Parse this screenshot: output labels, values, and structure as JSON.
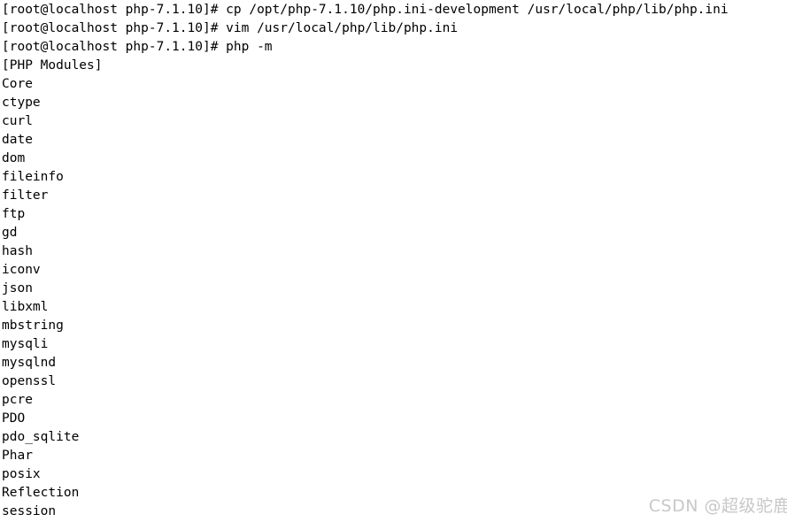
{
  "terminal": {
    "prompt": "[root@localhost php-7.1.10]#",
    "background_color": "#ffffff",
    "text_color": "#000000",
    "lines": [
      "[root@localhost php-7.1.10]# cp /opt/php-7.1.10/php.ini-development /usr/local/php/lib/php.ini",
      "[root@localhost php-7.1.10]# vim /usr/local/php/lib/php.ini",
      "[root@localhost php-7.1.10]# php -m",
      "[PHP Modules]",
      "Core",
      "ctype",
      "curl",
      "date",
      "dom",
      "fileinfo",
      "filter",
      "ftp",
      "gd",
      "hash",
      "iconv",
      "json",
      "libxml",
      "mbstring",
      "mysqli",
      "mysqlnd",
      "openssl",
      "pcre",
      "PDO",
      "pdo_sqlite",
      "Phar",
      "posix",
      "Reflection",
      "session"
    ]
  },
  "watermark": {
    "text": "CSDN @超级驼鹿",
    "color": "#c8c8c8"
  }
}
